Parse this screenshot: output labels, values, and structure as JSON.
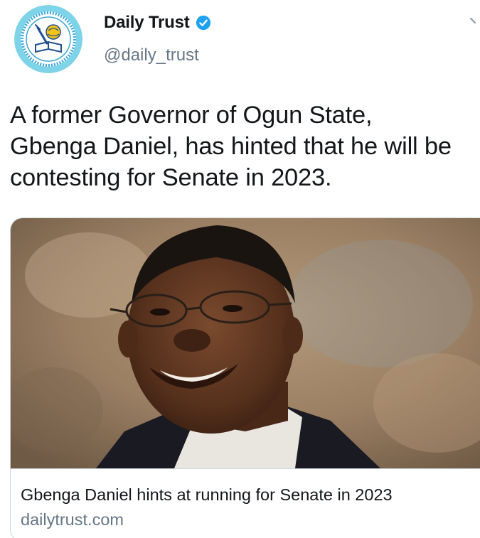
{
  "author": {
    "display_name": "Daily Trust",
    "handle": "@daily_trust",
    "verified": true,
    "verified_icon": "verified-badge-icon",
    "avatar_icon": "daily-trust-logo"
  },
  "tweet": {
    "text_lines": [
      "A former Governor of Ogun State,",
      "Gbenga Daniel, has hinted that he will be",
      "contesting for Senate in 2023."
    ]
  },
  "card": {
    "image": "photo-of-gbenga-daniel",
    "title": "Gbenga Daniel hints at running for Senate in 2023",
    "domain": "dailytrust.com"
  },
  "menu": {
    "icon": "chevron-down-icon"
  },
  "colors": {
    "text_primary": "#14171a",
    "text_secondary": "#657786",
    "verified_blue": "#1da1f2",
    "border": "#ccd6dd"
  }
}
